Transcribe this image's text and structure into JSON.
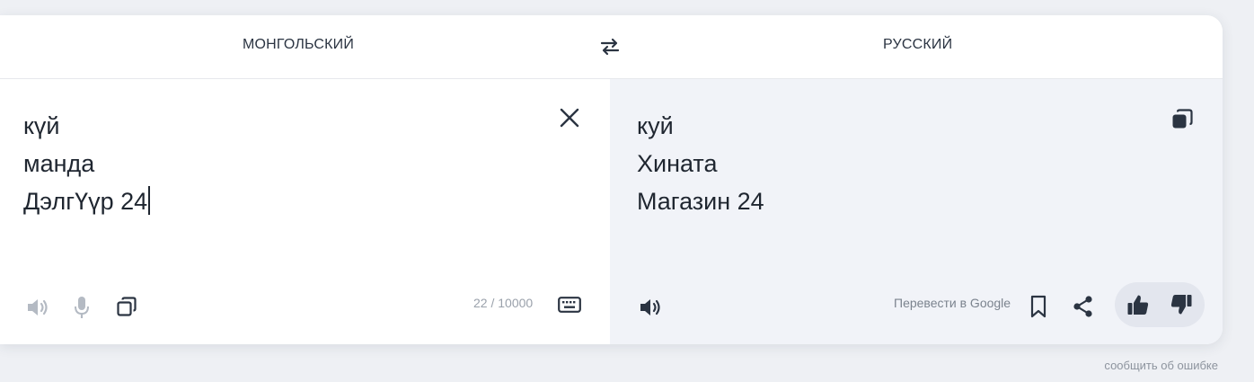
{
  "languages": {
    "source": "МОНГОЛЬСКИЙ",
    "target": "РУССКИЙ"
  },
  "source": {
    "lines": [
      "күй",
      "манда",
      "ДэлгҮүр 24"
    ],
    "counter": "22 / 10000"
  },
  "result": {
    "lines": [
      "куй",
      "Хината",
      "Магазин 24"
    ],
    "google_link": "Перевести в Google"
  },
  "footer": {
    "report_link": "сообщить об ошибке"
  },
  "icons": {
    "swap": "swap-arrows-icon",
    "clear": "close-icon",
    "speaker_source": "speaker-icon",
    "microphone": "microphone-icon",
    "copy_source": "copy-icon",
    "keyboard": "keyboard-icon",
    "copy_result": "copy-icon",
    "speaker_result": "speaker-icon",
    "bookmark": "bookmark-icon",
    "share": "share-icon",
    "like": "thumbs-up-icon",
    "dislike": "thumbs-down-icon"
  },
  "colors": {
    "page_background": "#eef0f4",
    "result_background": "#f1f3f8",
    "text": "#1f2630",
    "muted": "#9aa1ab"
  }
}
